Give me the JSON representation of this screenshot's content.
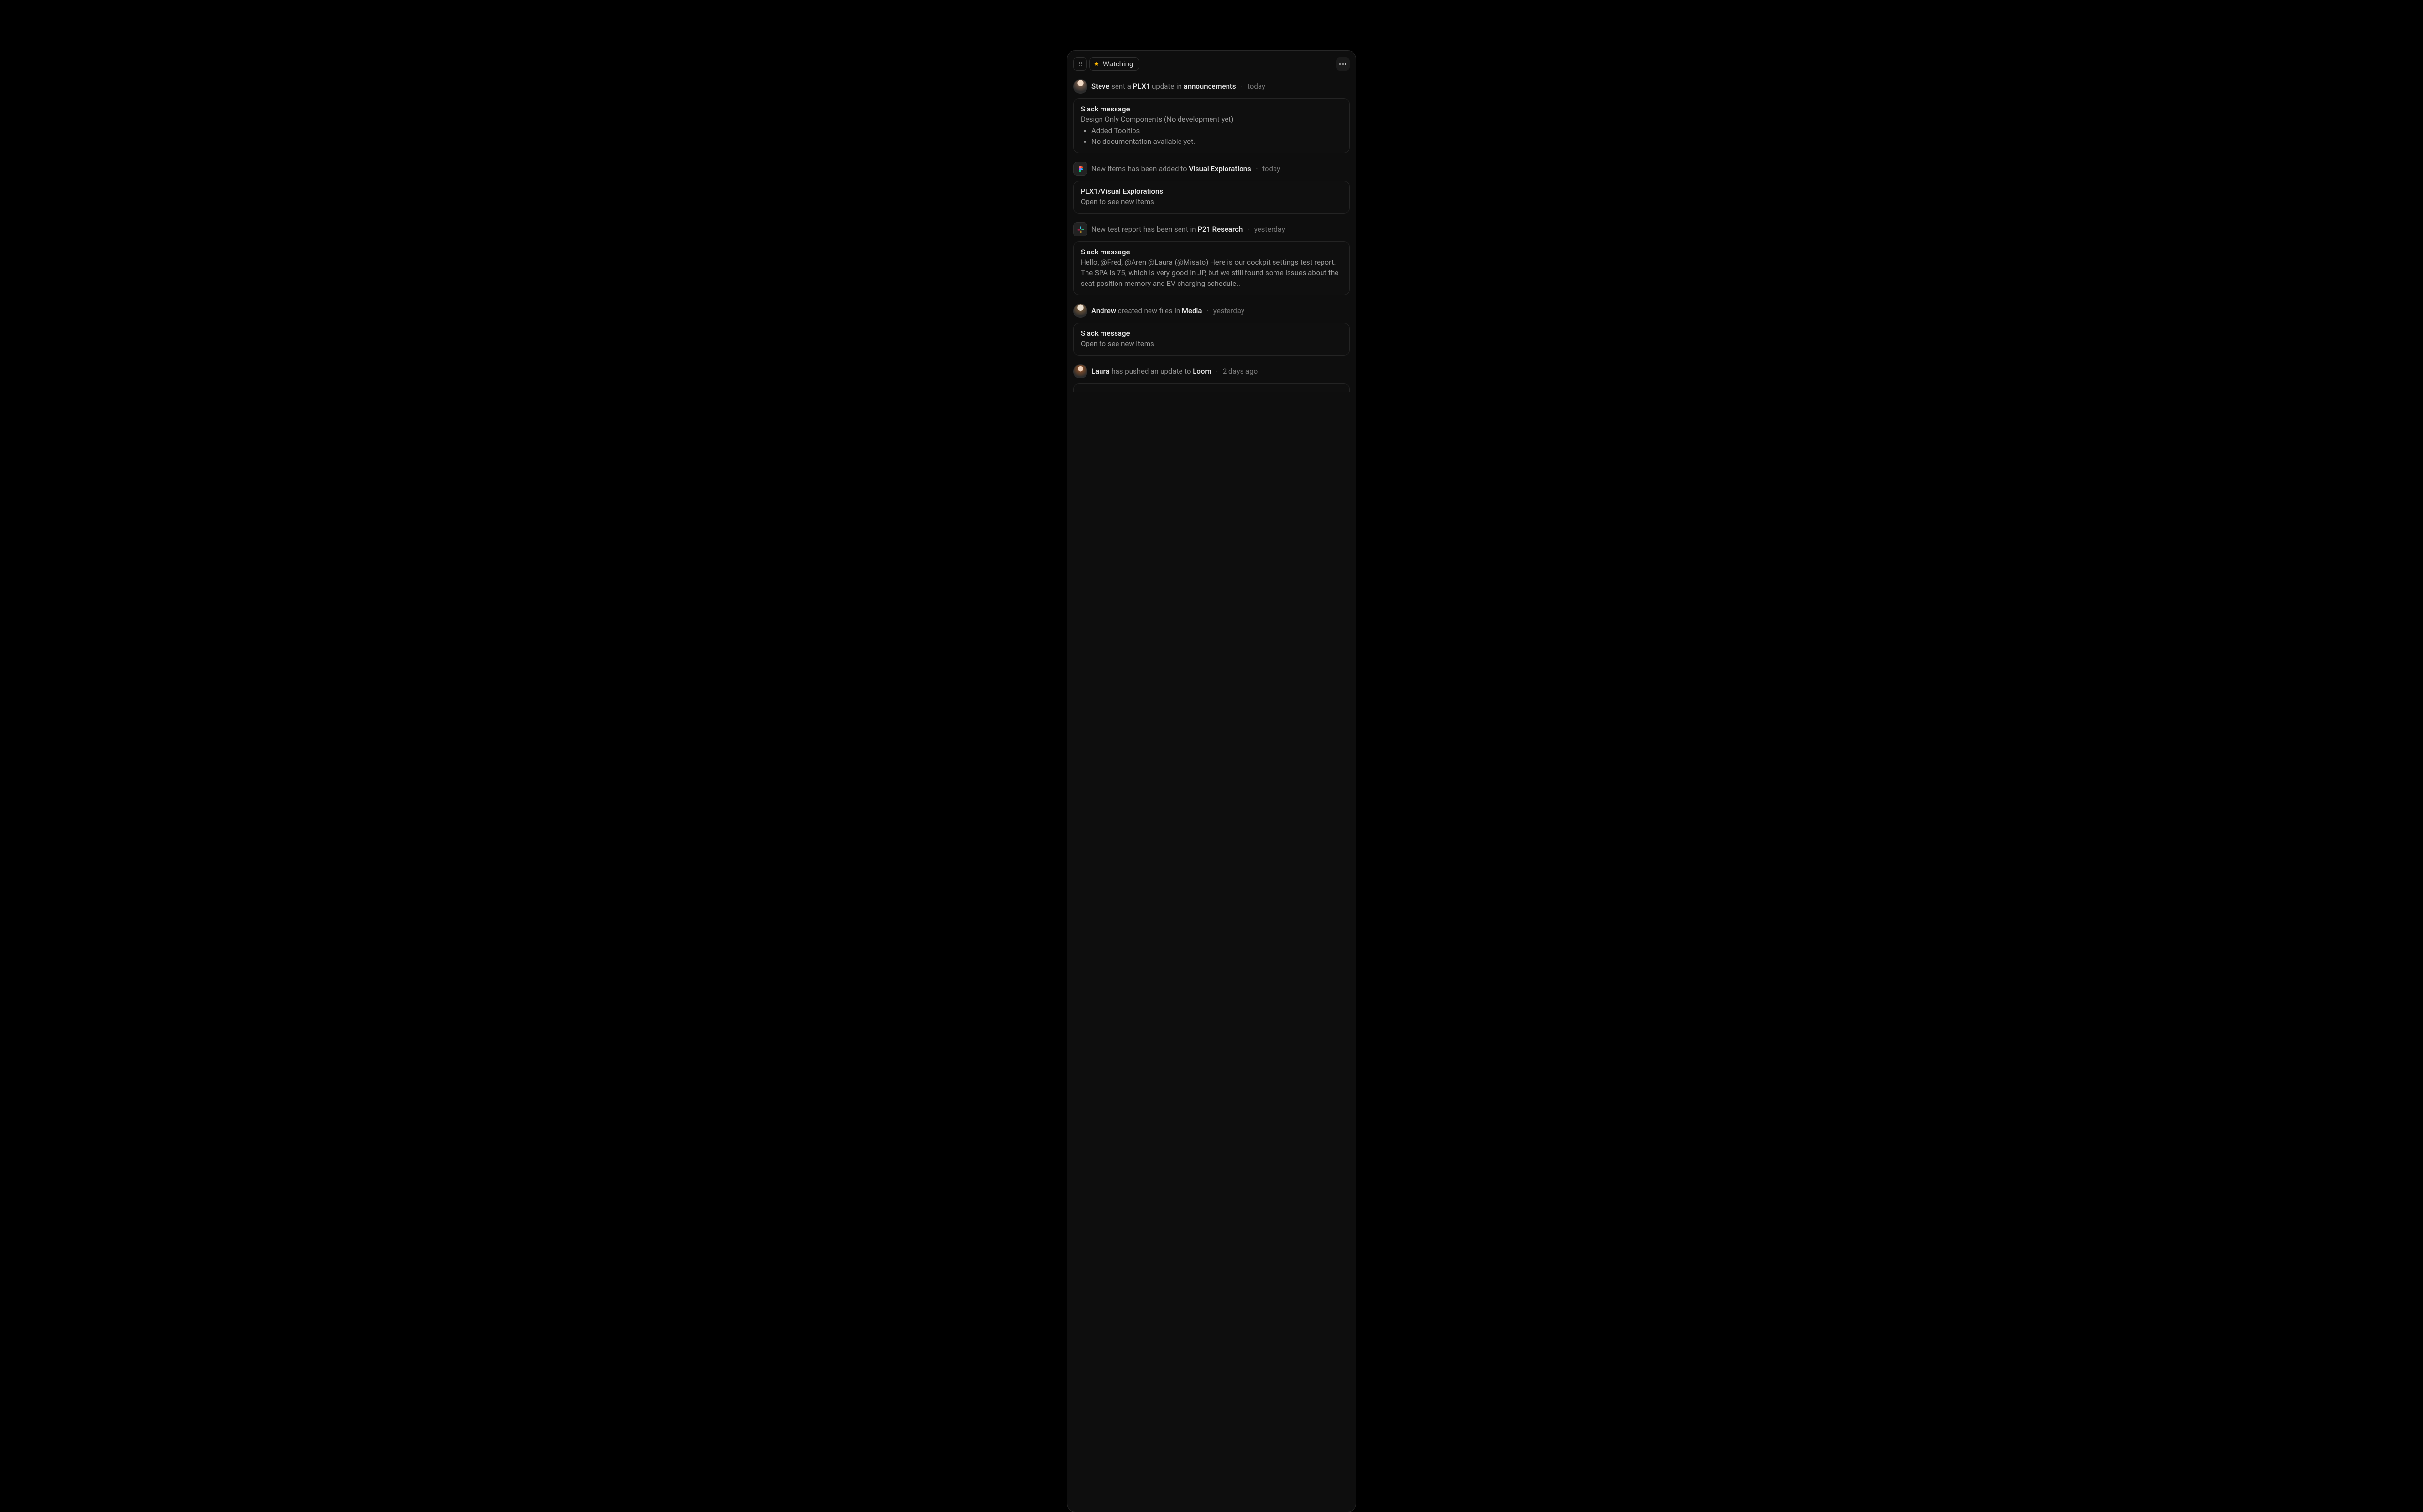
{
  "header": {
    "watching_label": "Watching"
  },
  "feed": [
    {
      "actor": "Steve",
      "verb_pre": "sent a",
      "target1": "PLX1",
      "verb_mid": "update in",
      "target2": "announcements",
      "time": "today",
      "card": {
        "title": "Slack message",
        "lead": "Design Only Components (No development yet)",
        "bullets": [
          "Added Tooltips",
          "No documentation available yet.."
        ]
      }
    },
    {
      "app": "figma",
      "line_pre": "New items has been added to",
      "target": "Visual Explorations",
      "time": "today",
      "card": {
        "title": "PLX1/Visual Explorations",
        "body": "Open to see new items"
      }
    },
    {
      "app": "slack",
      "line_pre": "New test report has been sent in",
      "target": "P21 Research",
      "time": "yesterday",
      "card": {
        "title": "Slack message",
        "body": "Hello, @Fred, @Aren @Laura (@Misato) Here is our cockpit settings test report. The SPA is 75, which is very good in JP, but we still found some issues about the seat position memory and EV charging schedule.."
      }
    },
    {
      "actor": "Andrew",
      "verb_pre": "created new files in",
      "target": "Media",
      "time": "yesterday",
      "card": {
        "title": "Slack message",
        "body": "Open to see new items"
      }
    },
    {
      "actor": "Laura",
      "verb_pre": "has pushed an update to",
      "target": "Loom",
      "time": "2 days ago"
    }
  ]
}
